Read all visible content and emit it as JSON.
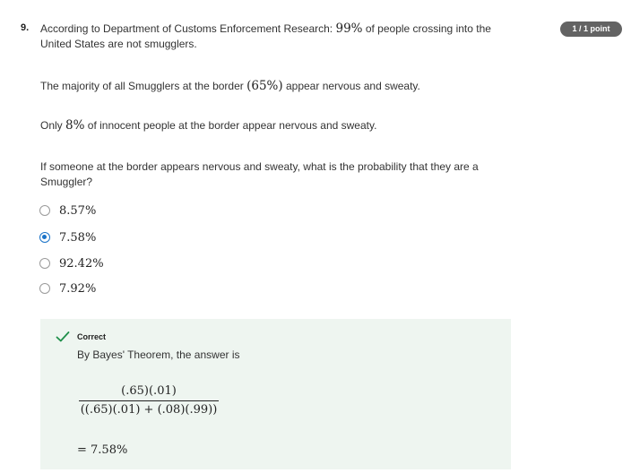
{
  "question": {
    "number": "9.",
    "points": "1 / 1 point",
    "line1_pre": "According to Department of Customs Enforcement Research: ",
    "line1_math": "99%",
    "line1_post": " of people crossing into the",
    "line2": "United States are not smugglers.",
    "p2_pre": "The majority of all Smugglers at the border ",
    "p2_math": "(65%)",
    "p2_post": " appear nervous and sweaty.",
    "p3_pre": "Only ",
    "p3_math": "8%",
    "p3_post": " of innocent people at the border appear nervous and sweaty.",
    "p4_line1": "If someone at the border appears nervous and sweaty, what is the probability that they are a",
    "p4_line2": "Smuggler?"
  },
  "options": [
    {
      "label": "8.57%",
      "selected": false
    },
    {
      "label": "7.58%",
      "selected": true
    },
    {
      "label": "92.42%",
      "selected": false
    },
    {
      "label": "7.92%",
      "selected": false
    }
  ],
  "feedback": {
    "status": "Correct",
    "explanation": "By Bayes' Theorem, the answer is",
    "numerator": "(.65)(.01)",
    "denominator": "((.65)(.01) + (.08)(.99))",
    "result": "= 7.58%",
    "status_color": "#1f8f4a",
    "background": "#eef5f0"
  },
  "colors": {
    "selected_radio": "#1a73c8",
    "points_badge": "#636363"
  }
}
